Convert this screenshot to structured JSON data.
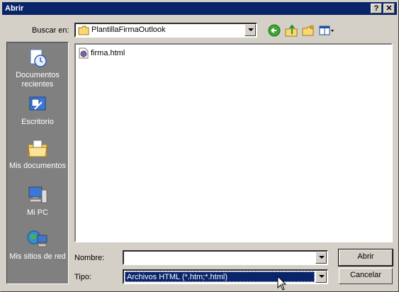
{
  "window": {
    "title": "Abrir"
  },
  "titlebar_buttons": {
    "help": "?",
    "close": "✕"
  },
  "lookin": {
    "label": "Buscar en:",
    "value": "PlantillaFirmaOutlook"
  },
  "toolbar": {
    "icons": [
      "back-icon",
      "up-folder-icon",
      "new-folder-icon",
      "view-menu-icon"
    ]
  },
  "places": [
    {
      "label": "Documentos recientes",
      "icon": "recent-documents-icon"
    },
    {
      "label": "Escritorio",
      "icon": "desktop-icon"
    },
    {
      "label": "Mis documentos",
      "icon": "my-documents-icon"
    },
    {
      "label": "Mi PC",
      "icon": "my-computer-icon"
    },
    {
      "label": "Mis sitios de red",
      "icon": "network-places-icon"
    }
  ],
  "files": [
    {
      "name": "firma.html",
      "icon": "html-file-icon"
    }
  ],
  "filename": {
    "label": "Nombre:",
    "value": ""
  },
  "filetype": {
    "label": "Tipo:",
    "value": "Archivos HTML (*.htm;*.html)"
  },
  "buttons": {
    "open": "Abrir",
    "cancel": "Cancelar"
  },
  "colors": {
    "titlebar": "#0a246a",
    "face": "#d4d0c8",
    "selection": "#0a246a"
  }
}
